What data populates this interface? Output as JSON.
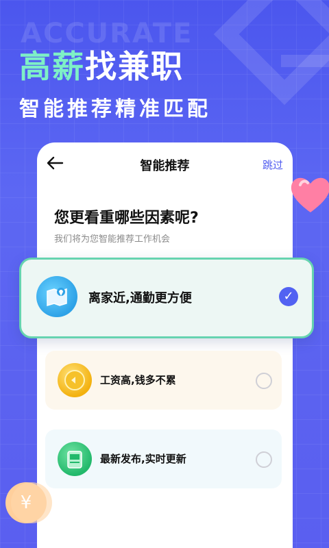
{
  "hero": {
    "ghost_word": "ACCURATE",
    "headline_highlight": "高薪",
    "headline_rest": "找兼职",
    "subline": "智能推荐精准匹配"
  },
  "nav": {
    "title": "智能推荐",
    "skip": "跳过"
  },
  "question": {
    "title": "您更看重哪些因素呢?",
    "subtitle": "我们将为您智能推荐工作机会"
  },
  "options": [
    {
      "label": "离家近,通勤更方便",
      "selected": true
    },
    {
      "label": "工资高,钱多不累",
      "selected": false
    },
    {
      "label": "最新发布,实时更新",
      "selected": false
    }
  ],
  "icons": {
    "back": "back-arrow-icon",
    "check": "checkmark-icon",
    "map": "map-icon",
    "coin": "coin-icon",
    "news": "news-icon",
    "heart": "heart-icon",
    "yen": "yen-coin-icon"
  },
  "colors": {
    "primary": "#4e5af0",
    "accent_green": "#7ef0c6",
    "selected_border": "#66d3b0"
  }
}
